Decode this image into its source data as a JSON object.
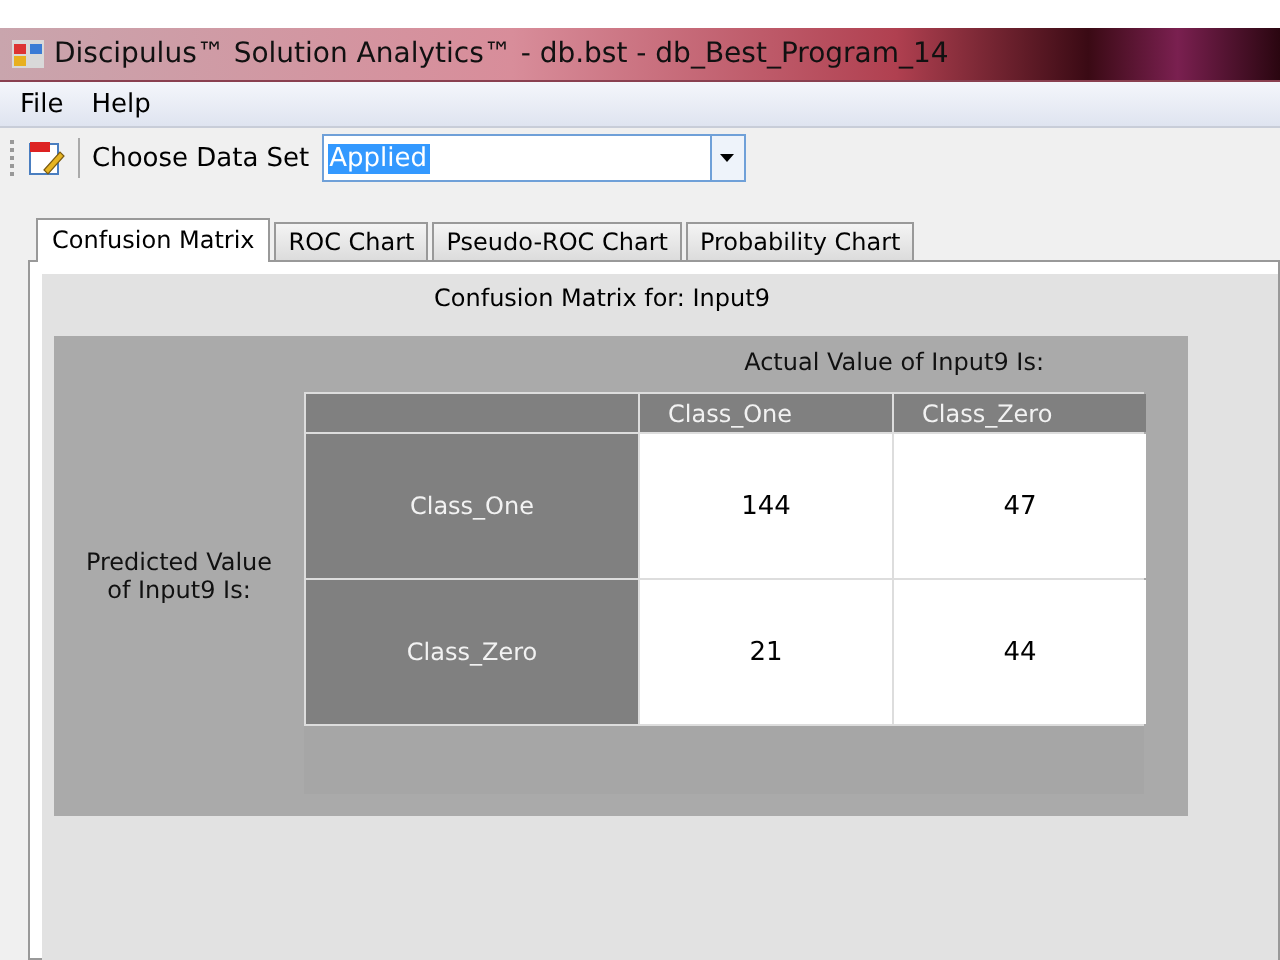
{
  "window": {
    "title": "Discipulus™ Solution Analytics™ - db.bst - db_Best_Program_14"
  },
  "menu": [
    "File",
    "Help"
  ],
  "toolbar": {
    "label": "Choose Data Set",
    "dataset": "Applied"
  },
  "tabs": [
    {
      "label": "Confusion Matrix",
      "selected": true
    },
    {
      "label": "ROC Chart",
      "selected": false
    },
    {
      "label": "Pseudo-ROC Chart",
      "selected": false
    },
    {
      "label": "Probability Chart",
      "selected": false
    }
  ],
  "matrix": {
    "title": "Confusion Matrix for: Input9",
    "actual_label": "Actual Value of Input9 Is:",
    "predicted_label": "Predicted Value of Input9 Is:",
    "columns": [
      "Class_One",
      "Class_Zero"
    ],
    "rows": [
      {
        "label": "Class_One",
        "values": [
          "144",
          "47"
        ]
      },
      {
        "label": "Class_Zero",
        "values": [
          "21",
          "44"
        ]
      }
    ]
  }
}
